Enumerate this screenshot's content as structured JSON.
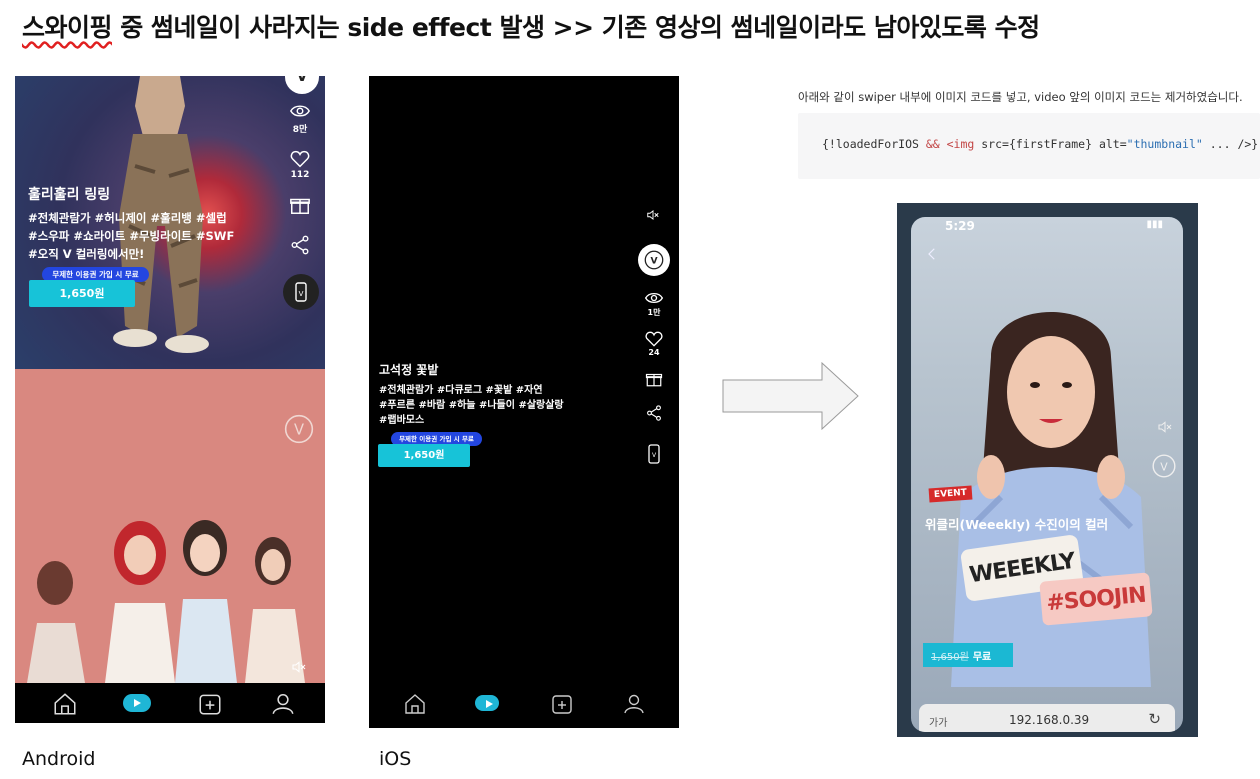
{
  "header": {
    "title_prefix_flagged": "스와이핑",
    "title_rest": " 중 썸네일이 사라지는 side effect 발생 >> 기존 영상의 썸네일이라도 남아있도록 수정"
  },
  "captions": {
    "android": "Android",
    "ios": "iOS"
  },
  "android": {
    "views": "8만",
    "likes": "112",
    "title": "훌리훌리 링링",
    "tags": [
      "#전체관람가 #허니제이 #훌리뱅 #셀럽",
      "#스우파 #쇼라이트 #무빙라이트 #SWF",
      "#오직 V 컬러링에서만!"
    ],
    "free_badge": "무제한 이용권 가입 시 무료",
    "price": "1,650원",
    "v_logo": "V"
  },
  "ios": {
    "views": "1만",
    "likes": "24",
    "title": "고석정 꽃밭",
    "tags": [
      "#전체관람가 #다큐로그 #꽃밭 #자연",
      "#푸르른 #바람 #하늘 #나들이 #살랑살랑",
      "#랩바모스"
    ],
    "free_badge": "무제한 이용권 가입 시 무료",
    "price": "1,650원",
    "v_logo": "V"
  },
  "explanation": {
    "text": "아래와 같이 swiper 내부에 이미지 코드를 넣고, video 앞의 이미지 코드는 제거하였습니다.",
    "code": {
      "p1": "{!loadedForIOS ",
      "p2": "&& <img",
      "p3": " src={firstFrame} alt=",
      "p4": "\"thumbnail\"",
      "p5": " ... />}"
    }
  },
  "photo": {
    "time": "5:29",
    "event": "EVENT",
    "title": "위클리(Weeekly) 수진이의 컬러",
    "sticker1": "WEEEKLY",
    "sticker2": "#SOOJIN",
    "price_strike": "1,650원",
    "price_free": "무료",
    "url_aa": "가가",
    "url": "192.168.0.39",
    "reload": "↻"
  },
  "colors": {
    "accent": "#17c3d8",
    "badge": "#2346e0",
    "flag": "#e02020"
  },
  "icons": [
    "eye-icon",
    "heart-icon",
    "gift-icon",
    "share-icon",
    "mute-icon",
    "home-icon",
    "play-icon",
    "add-video-icon",
    "profile-icon",
    "right-arrow-icon"
  ]
}
